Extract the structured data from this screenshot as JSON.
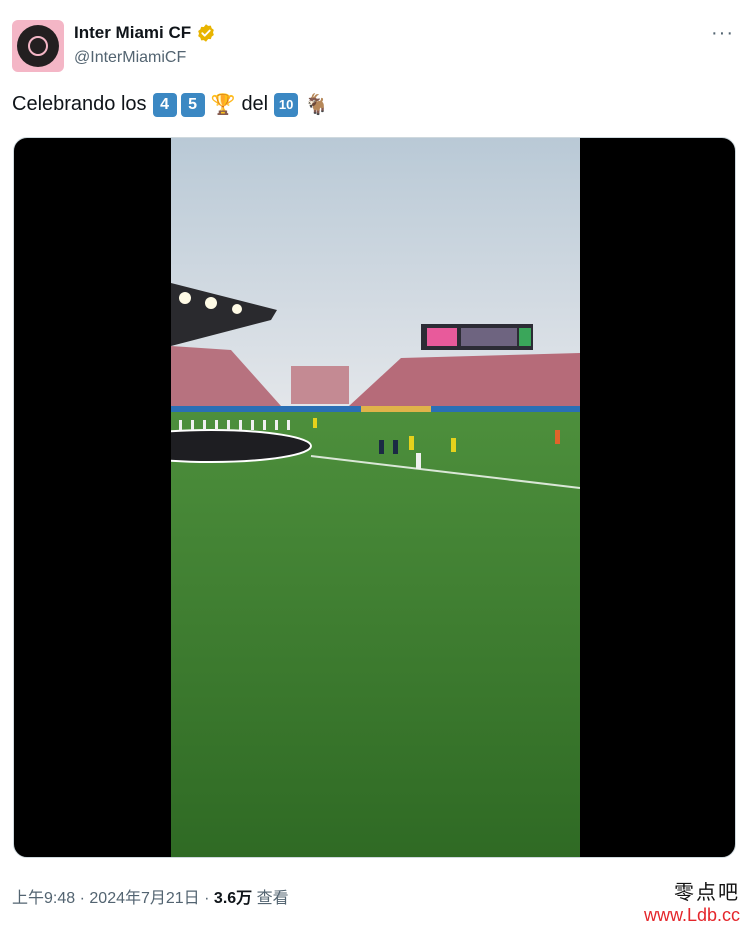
{
  "account": {
    "display_name": "Inter Miami CF",
    "handle": "@InterMiamiCF",
    "verified_color": "#e8b400",
    "more_label": "···"
  },
  "tweet": {
    "text_prefix": "Celebrando los",
    "keycap_1": "4",
    "keycap_2": "5",
    "trophy_emoji": "🏆",
    "text_mid": "del",
    "keycap_3": "10",
    "goat_emoji": "🐐"
  },
  "media": {
    "type": "video",
    "icon": "stadium-video-frame"
  },
  "meta": {
    "time": "上午9:48",
    "sep1": "·",
    "date": "2024年7月21日",
    "sep2": "·",
    "views_count": "3.6万",
    "views_label": "查看"
  },
  "watermark": {
    "site_name": "零点吧",
    "url": "www.Ldb.cc"
  },
  "colors": {
    "keycap": "#3b88c3",
    "secondary_text": "#536471",
    "watermark_url": "#e4262b",
    "avatar_bg": "#f4b6c6"
  }
}
